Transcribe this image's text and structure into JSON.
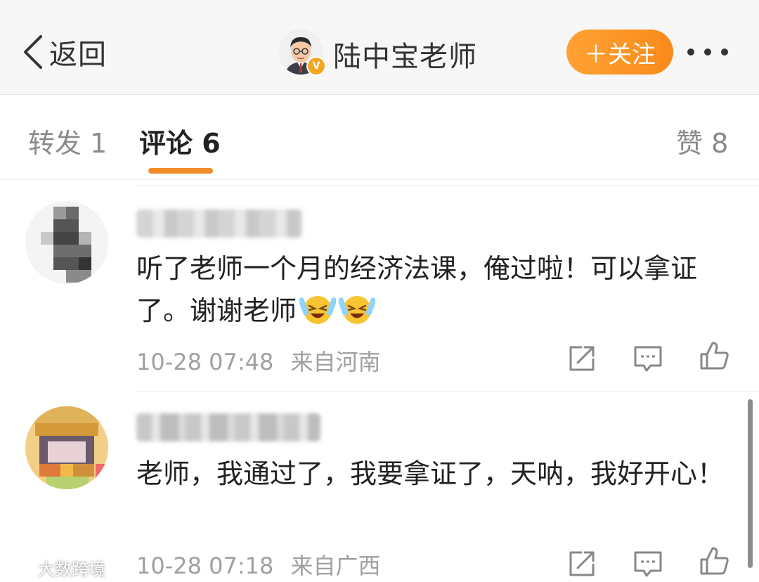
{
  "header": {
    "back_label": "返回",
    "user_name": "陆中宝老师",
    "verified_badge": "V",
    "follow_label": "＋关注",
    "more_icon": "more-dots-icon"
  },
  "tabs": [
    {
      "label": "转发 1"
    },
    {
      "label": "评论 6"
    },
    {
      "label": "赞 8"
    }
  ],
  "comments": [
    {
      "text": "听了老师一个月的经济法课，俺过啦！可以拿证了。谢谢老师",
      "emoji": "laugh-cry-emoji",
      "time": "10-28 07:48",
      "location": "来自河南"
    },
    {
      "text": "老师，我通过了，我要拿证了，天呐，我好开心！",
      "time": "10-28 07:18",
      "location": "来自广西"
    }
  ],
  "watermark": "大数跨境",
  "colors": {
    "accent": "#f08d2a",
    "follow": "#f98a1b",
    "meta": "#a0a0a0"
  }
}
